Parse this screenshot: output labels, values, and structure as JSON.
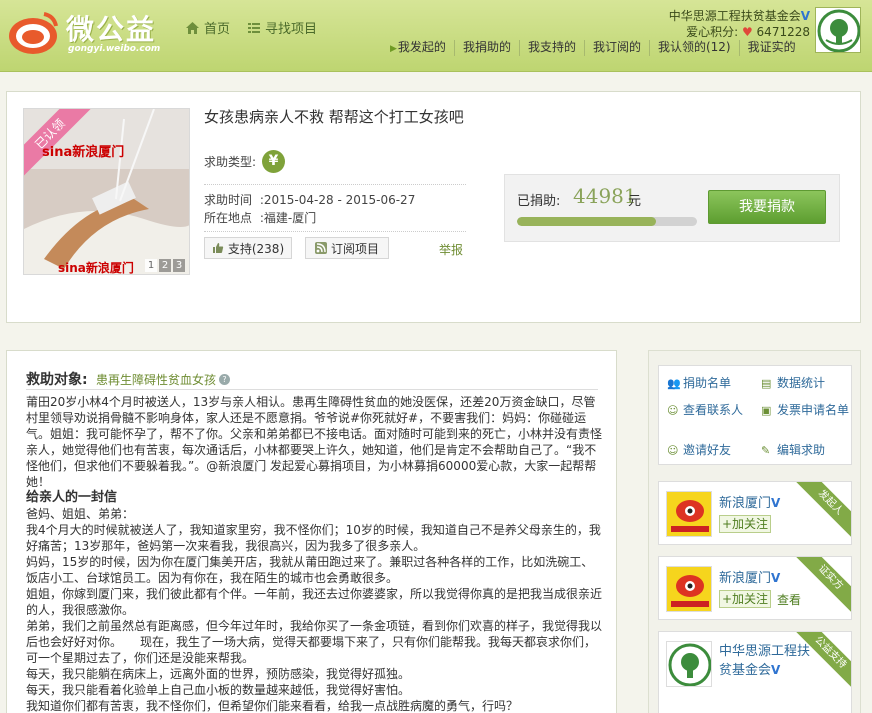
{
  "brand": {
    "name": "微公益",
    "sub": "gongyi.weibo.com"
  },
  "nav": [
    {
      "label": "首页",
      "icon": "home-icon"
    },
    {
      "label": "寻找项目",
      "icon": "list-icon"
    }
  ],
  "org": {
    "name": "中华思源工程扶贫基金会",
    "score_label": "爱心积分:",
    "score": "6471228"
  },
  "user_links": [
    "我发起的",
    "我捐助的",
    "我支持的",
    "我订阅的",
    "我认领的(12)",
    "我证实的"
  ],
  "project": {
    "badge": "已认领",
    "title": "女孩患病亲人不救 帮帮这个打工女孩吧",
    "help_type_label": "求助类型:",
    "help_type_icon": "yen-icon",
    "time_label": "求助时间",
    "time_value": ":2015-04-28 - 2015-06-27",
    "location_label": "所在地点",
    "location_value": ":福建-厦门",
    "support_label": "支持(238)",
    "subscribe_label": "订阅项目",
    "report_label": "举报",
    "photo_pages": [
      "1",
      "2",
      "3"
    ],
    "photo_watermark_top": "sina新浪厦门",
    "photo_watermark_bottom": "sina新浪厦门"
  },
  "donation": {
    "label": "已捐助:",
    "amount": "44981",
    "unit": "元",
    "progress": 0.77,
    "button": "我要捐款"
  },
  "detail": {
    "target_label": "救助对象:",
    "target_name": "患再生障碍性贫血女孩",
    "paragraphs": [
      {
        "t": "莆田20岁小林4个月时被送人，13岁与亲人相认。患再生障碍性贫血的她没医保，还差20万资金缺口，尽管村里领导劝说捐骨髓不影响身体，家人还是不愿意捐。爷爷说#你死就好#，不要害我们：妈妈：你碰碰运气。姐姐：我可能怀孕了，帮不了你。父亲和弟弟都已不接电话。面对随时可能到来的死亡，小林并没有责怪亲人，她觉得他们也有苦衷，每次通话后，小林都要哭上许久，她知道，他们是肯定不会帮助自己了。“我不怪他们，但求他们不要躲着我。”。@新浪厦门 发起爱心募捐项目，为小林募捐60000爱心款，大家一起帮帮她！",
        "h": false
      },
      {
        "t": "给亲人的一封信",
        "h": true
      },
      {
        "t": "爸妈、姐姐、弟弟：",
        "h": false
      },
      {
        "t": "我4个月大的时候就被送人了，我知道家里穷，我不怪你们；10岁的时候，我知道自己不是养父母亲生的，我好痛苦；13岁那年，爸妈第一次来看我，我很高兴，因为我多了很多亲人。",
        "h": false
      },
      {
        "t": "妈妈，15岁的时候，因为你在厦门集美开店，我就从莆田跑过来了。兼职过各种各样的工作，比如洗碗工、饭店小工、台球馆员工。因为有你在，我在陌生的城市也会勇敢很多。",
        "h": false
      },
      {
        "t": "姐姐，你嫁到厦门来，我们彼此都有个伴。一年前，我还去过你婆婆家，所以我觉得你真的是把我当成很亲近的人，我很感激你。",
        "h": false
      },
      {
        "t": "弟弟，我们之前虽然总有距离感，但今年过年时，我给你买了一条金项链，看到你们欢喜的样子，我觉得我以后也会好好对你。　　现在，我生了一场大病，觉得天都要塌下来了，只有你们能帮我。我每天都哀求你们，可一个星期过去了，你们还是没能来帮我。",
        "h": false
      },
      {
        "t": "每天，我只能躺在病床上，远离外面的世界，预防感染，我觉得好孤独。",
        "h": false
      },
      {
        "t": "每天，我只能看着化验单上自己血小板的数量越来越低，我觉得好害怕。",
        "h": false
      },
      {
        "t": "我知道你们都有苦衷，我不怪你们，但希望你们能来看看，给我一点战胜病魔的勇气，行吗？",
        "h": false
      }
    ]
  },
  "side_menu": [
    {
      "label": "捐助名单",
      "icon": "users-icon"
    },
    {
      "label": "数据统计",
      "icon": "stats-icon"
    },
    {
      "label": "查看联系人",
      "icon": "contact-icon"
    },
    {
      "label": "发票申请名单",
      "icon": "invoice-icon"
    },
    {
      "label": "邀请好友",
      "icon": "invite-icon"
    },
    {
      "label": "编辑求助",
      "icon": "edit-icon"
    }
  ],
  "side_cards": [
    {
      "name": "新浪厦门",
      "follow": "+加关注",
      "view": "",
      "ribbon": "发起人"
    },
    {
      "name": "新浪厦门",
      "follow": "+加关注",
      "view": "查看",
      "ribbon": "证实方"
    },
    {
      "name": "中华思源工程扶贫基金会",
      "follow": "",
      "view": "",
      "ribbon": "公益支持"
    }
  ],
  "colors": {
    "accent": "#6f8d33",
    "topbar": "#c9dc85",
    "button": "#6aa83b",
    "link": "#2f6a9a"
  }
}
